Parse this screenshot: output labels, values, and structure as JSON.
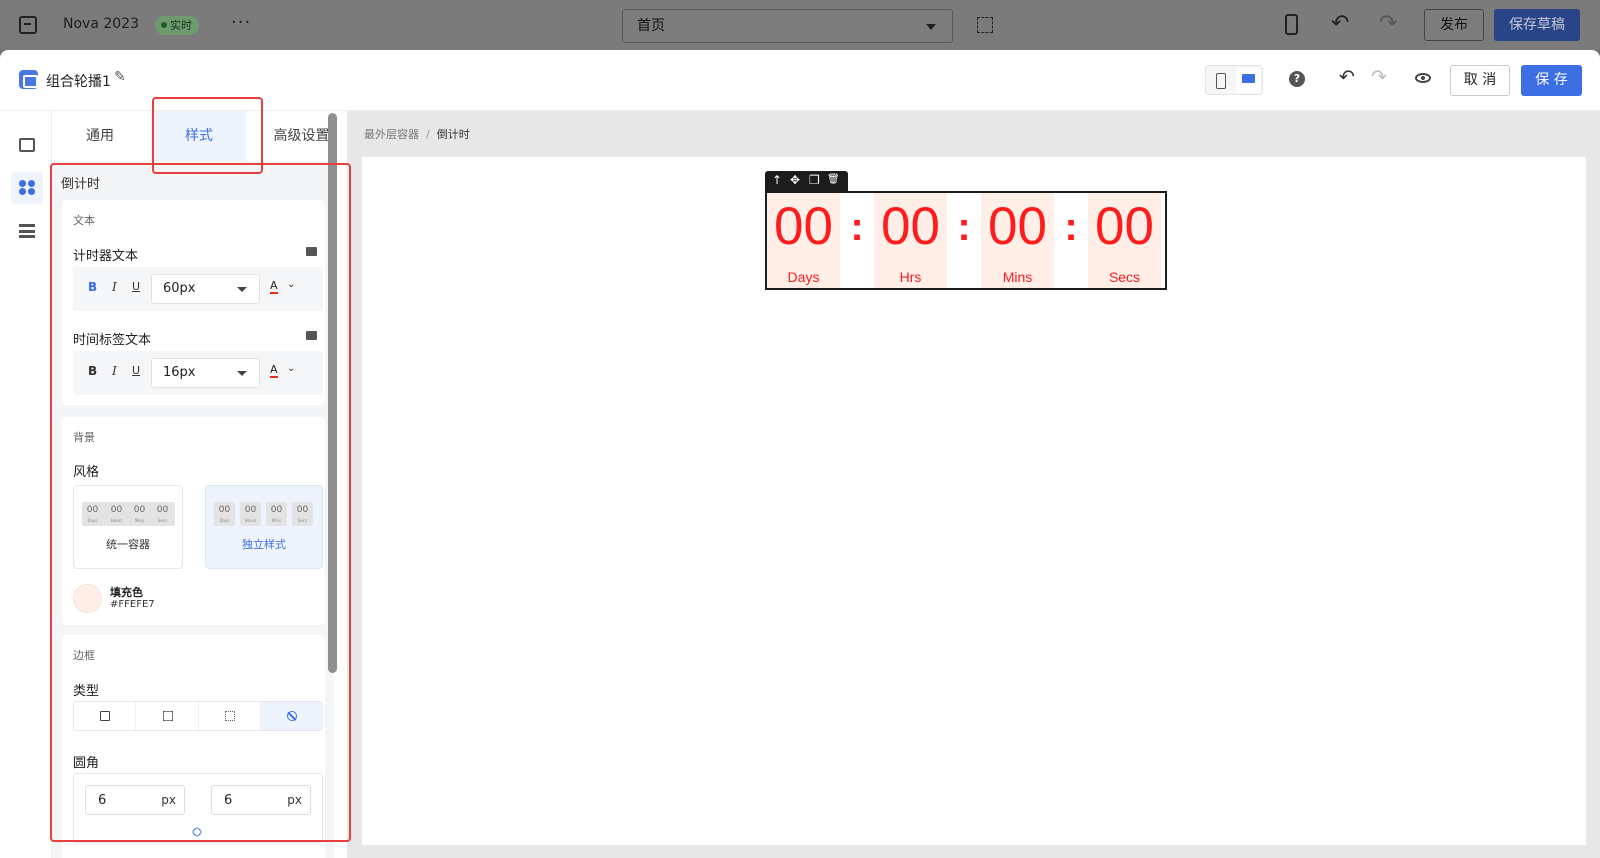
{
  "topbar": {
    "app_title": "Nova 2023",
    "live_badge": "实时",
    "more": "···",
    "page_select": "首页",
    "publish_label": "发布",
    "save_draft_label": "保存草稿"
  },
  "header": {
    "component_title": "组合轮播1",
    "cancel_label": "取 消",
    "save_label": "保 存"
  },
  "tabs": [
    {
      "label": "通用"
    },
    {
      "label": "样式"
    },
    {
      "label": "高级设置"
    }
  ],
  "panel": {
    "section_title": "倒计时",
    "text": {
      "card_label": "文本",
      "timer_text_label": "计时器文本",
      "timer_text_size": "60px",
      "time_label_text_label": "时间标签文本",
      "time_label_size": "16px",
      "bold": "B",
      "italic": "I",
      "underline": "U",
      "font_color": "A",
      "font_color_caret": "⌄"
    },
    "background": {
      "card_label": "背景",
      "style_label": "风格",
      "preview_digits": "00",
      "preview_captions": [
        "Days",
        "Hours",
        "Mins",
        "Secs"
      ],
      "option_unified": "统一容器",
      "option_independent": "独立样式",
      "fill_label": "填充色",
      "fill_value": "#FFEFE7"
    },
    "border": {
      "card_label": "边框",
      "type_label": "类型",
      "radius_label": "圆角",
      "radius_left_value": "6",
      "radius_right_value": "6",
      "unit": "px"
    }
  },
  "canvas": {
    "breadcrumb_root": "最外层容器",
    "breadcrumb_sep": "/",
    "breadcrumb_current": "倒计时",
    "toolbar_icons": [
      "↑",
      "✥",
      "❐",
      "🗑"
    ],
    "countdown": {
      "separator": ":",
      "units": [
        {
          "value": "00",
          "label": "Days"
        },
        {
          "value": "00",
          "label": "Hrs"
        },
        {
          "value": "00",
          "label": "Mins"
        },
        {
          "value": "00",
          "label": "Secs"
        }
      ],
      "digit_color": "#FF1C1C",
      "fill_color": "#FFEFE7"
    }
  },
  "colors": {
    "accent": "#3B6FE3",
    "highlight": "#E8403F"
  }
}
